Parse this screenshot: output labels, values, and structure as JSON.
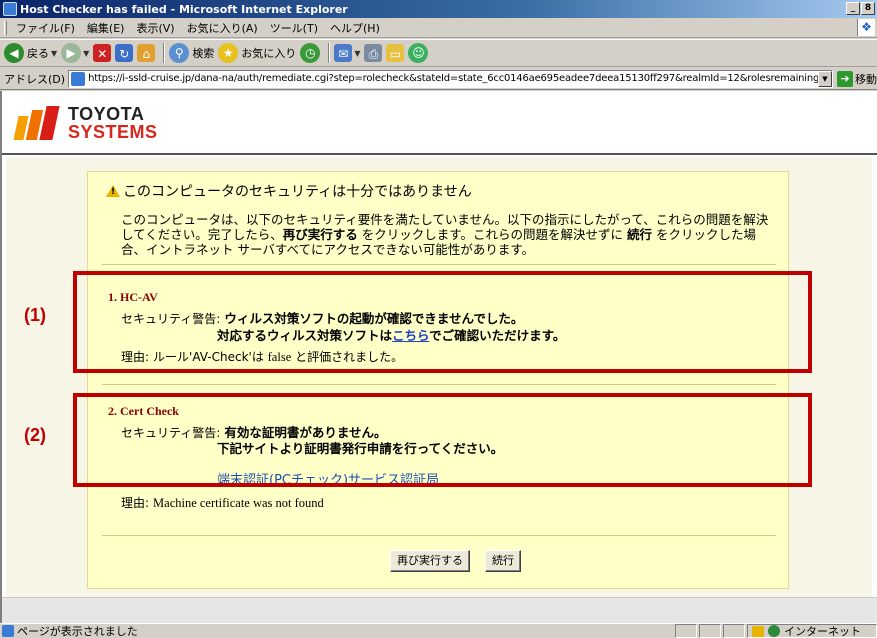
{
  "window": {
    "title": "Host Checker has failed - Microsoft Internet Explorer",
    "minimize_glyph": "_",
    "maximize_glyph": "8"
  },
  "menubar": {
    "items": [
      "ファイル(F)",
      "編集(E)",
      "表示(V)",
      "お気に入り(A)",
      "ツール(T)",
      "ヘルプ(H)"
    ]
  },
  "toolbar": {
    "back_label": "戻る",
    "search_label": "検索",
    "favorites_label": "お気に入り"
  },
  "addressbar": {
    "label": "アドレス(D)",
    "url": "https://i-ssld-cruise.jp/dana-na/auth/remediate.cgi?step=rolecheck&stateId=state_6cc0146ae695eadee7deea15130ff297&realmId=12&rolesremaining=3&realmsremainir",
    "go_label": "移動"
  },
  "logo": {
    "line1": "TOYOTA",
    "line2": "SYSTEMS"
  },
  "notice": {
    "heading": "このコンピュータのセキュリティは十分ではありません",
    "body_part1": "このコンピュータは、以下のセキュリティ要件を満たしていません。以下の指示にしたがって、これらの問題を解決してください。完了したら、",
    "body_retry": "再び実行する",
    "body_part2": " をクリックします。これらの問題を解決せずに ",
    "body_continue": "続行",
    "body_part3": " をクリックした場合、イントラネット サーバすべてにアクセスできない可能性があります。"
  },
  "section1": {
    "title": "1. HC-AV",
    "warning_label": "セキュリティ警告:",
    "message_line1": "ウィルス対策ソフトの起動が確認できませんでした。",
    "message_line2_pre": "対応するウィルス対策ソフトは",
    "message_link": "こちら",
    "message_line2_post": "でご確認いただけます。",
    "reason_label": "理由:",
    "reason_text_pre": "ルール'AV-Check'は ",
    "reason_text_false": "false",
    "reason_text_post": " と評価されました。"
  },
  "section2": {
    "title": "2. Cert Check",
    "warning_label": "セキュリティ警告:",
    "message_line1": "有効な証明書がありません。",
    "message_line2": "下記サイトより証明書発行申請を行ってください。",
    "ca_link": "端末認証(PCチェック)サービス認証局",
    "reason_label": "理由:",
    "reason_text": "Machine certificate was not found"
  },
  "buttons": {
    "retry": "再び実行する",
    "continue": "続行"
  },
  "annotations": {
    "label1": "(1)",
    "label2": "(2)",
    "box_color": "#c00000"
  },
  "statusbar": {
    "text": "ページが表示されました",
    "zone": "インターネット"
  }
}
